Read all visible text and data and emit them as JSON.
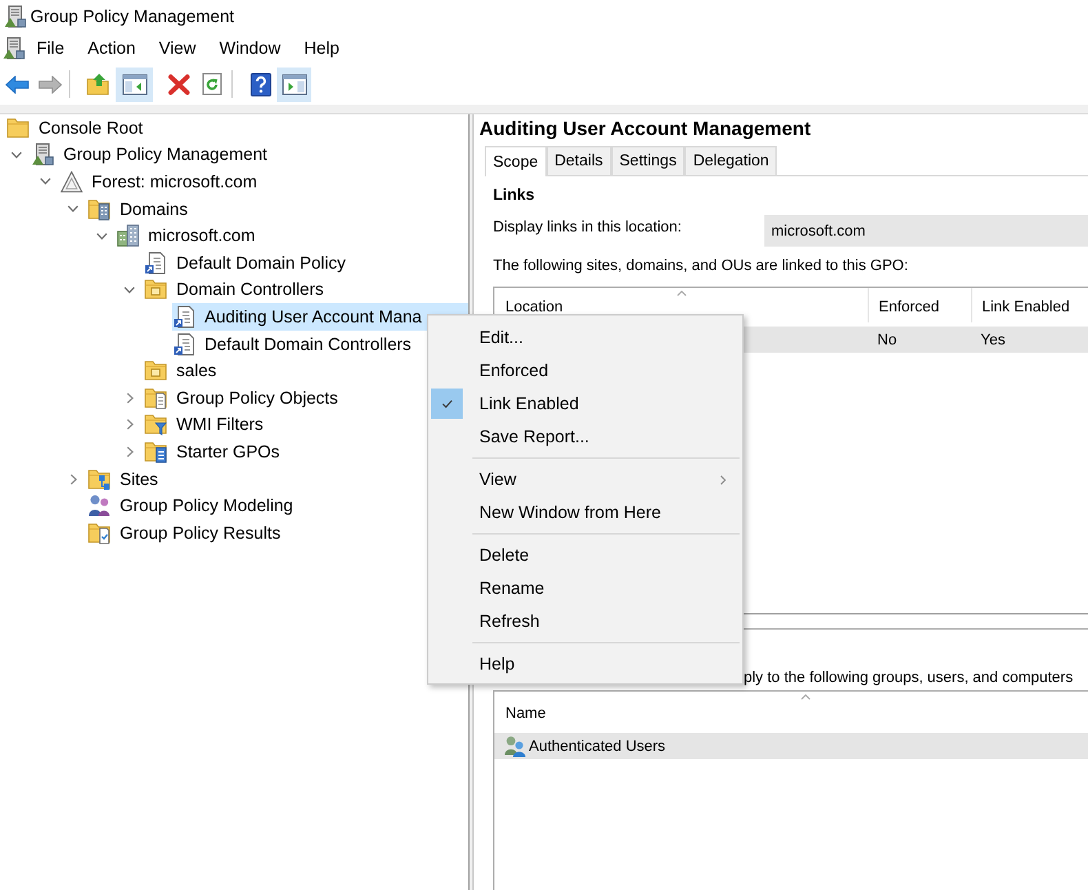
{
  "window": {
    "title": "Group Policy Management"
  },
  "menu_bar": [
    "File",
    "Action",
    "View",
    "Window",
    "Help"
  ],
  "toolbar": [
    {
      "kind": "back",
      "disabled": false,
      "pressed": false
    },
    {
      "kind": "forward",
      "disabled": true,
      "pressed": false
    },
    {
      "kind": "separator"
    },
    {
      "kind": "up-folder",
      "disabled": false,
      "pressed": false
    },
    {
      "kind": "console-tree",
      "disabled": false,
      "pressed": true
    },
    {
      "kind": "delete",
      "disabled": false,
      "pressed": false
    },
    {
      "kind": "refresh",
      "disabled": false,
      "pressed": false
    },
    {
      "kind": "separator"
    },
    {
      "kind": "help",
      "disabled": false,
      "pressed": false
    },
    {
      "kind": "action-pane",
      "disabled": false,
      "pressed": true
    }
  ],
  "tree": [
    {
      "label": "Console Root",
      "kind": "console-root",
      "selected": false,
      "children": [
        {
          "label": "Group Policy Management",
          "kind": "gpm",
          "expanded": true,
          "selected": false,
          "children": [
            {
              "label": "Forest: microsoft.com",
              "kind": "forest",
              "expanded": true,
              "selected": false,
              "children": [
                {
                  "label": "Domains",
                  "kind": "domains",
                  "expanded": true,
                  "selected": false,
                  "children": [
                    {
                      "label": "microsoft.com",
                      "kind": "domain",
                      "expanded": true,
                      "selected": false,
                      "children": [
                        {
                          "label": "Default Domain Policy",
                          "kind": "gpo-link",
                          "selected": false
                        },
                        {
                          "label": "Domain Controllers",
                          "kind": "ou",
                          "expanded": true,
                          "selected": false,
                          "children": [
                            {
                              "label": "Auditing User Account Mana",
                              "kind": "gpo-link",
                              "selected": true
                            },
                            {
                              "label": "Default Domain Controllers",
                              "kind": "gpo-link",
                              "selected": false
                            }
                          ]
                        },
                        {
                          "label": "sales",
                          "kind": "ou",
                          "selected": false
                        },
                        {
                          "label": "Group Policy Objects",
                          "kind": "gpo-container",
                          "expanded": false,
                          "selected": false
                        },
                        {
                          "label": "WMI Filters",
                          "kind": "wmi",
                          "expanded": false,
                          "selected": false
                        },
                        {
                          "label": "Starter GPOs",
                          "kind": "starter",
                          "expanded": false,
                          "selected": false
                        }
                      ]
                    }
                  ]
                },
                {
                  "label": "Sites",
                  "kind": "sites",
                  "expanded": false,
                  "selected": false
                },
                {
                  "label": "Group Policy Modeling",
                  "kind": "modeling",
                  "selected": false
                },
                {
                  "label": "Group Policy Results",
                  "kind": "results",
                  "selected": false
                }
              ]
            }
          ]
        }
      ]
    }
  ],
  "details": {
    "title": "Auditing User Account Management",
    "tabs": [
      {
        "label": "Scope",
        "selected": true
      },
      {
        "label": "Details",
        "selected": false
      },
      {
        "label": "Settings",
        "selected": false
      },
      {
        "label": "Delegation",
        "selected": false
      }
    ],
    "links": {
      "heading": "Links",
      "location_label": "Display links in this location:",
      "location_value": "microsoft.com",
      "caption": "The following sites, domains, and OUs are linked to this GPO:",
      "columns": [
        {
          "label": "Location",
          "sorted": true
        },
        {
          "label": "Enforced",
          "sorted": false
        },
        {
          "label": "Link Enabled",
          "sorted": false
        }
      ],
      "rows": [
        {
          "enforced": "No",
          "link_enabled": "Yes",
          "selected": true
        }
      ]
    },
    "security_filtering": {
      "caption": "ply to the following groups, users, and computers",
      "columns": [
        {
          "label": "Name",
          "sorted": true
        }
      ],
      "rows": [
        {
          "name": "Authenticated Users",
          "selected": true
        }
      ]
    }
  },
  "context_menu": {
    "sections": [
      {
        "items": [
          {
            "label": "Edit...",
            "checked": false,
            "submenu": false
          },
          {
            "label": "Enforced",
            "checked": false,
            "submenu": false
          },
          {
            "label": "Link Enabled",
            "checked": true,
            "submenu": false
          },
          {
            "label": "Save Report...",
            "checked": false,
            "submenu": false
          }
        ]
      },
      {
        "items": [
          {
            "label": "View",
            "checked": false,
            "submenu": true
          },
          {
            "label": "New Window from Here",
            "checked": false,
            "submenu": false
          }
        ]
      },
      {
        "items": [
          {
            "label": "Delete",
            "checked": false,
            "submenu": false
          },
          {
            "label": "Rename",
            "checked": false,
            "submenu": false
          },
          {
            "label": "Refresh",
            "checked": false,
            "submenu": false
          }
        ]
      },
      {
        "items": [
          {
            "label": "Help",
            "checked": false,
            "submenu": false
          }
        ]
      }
    ]
  }
}
